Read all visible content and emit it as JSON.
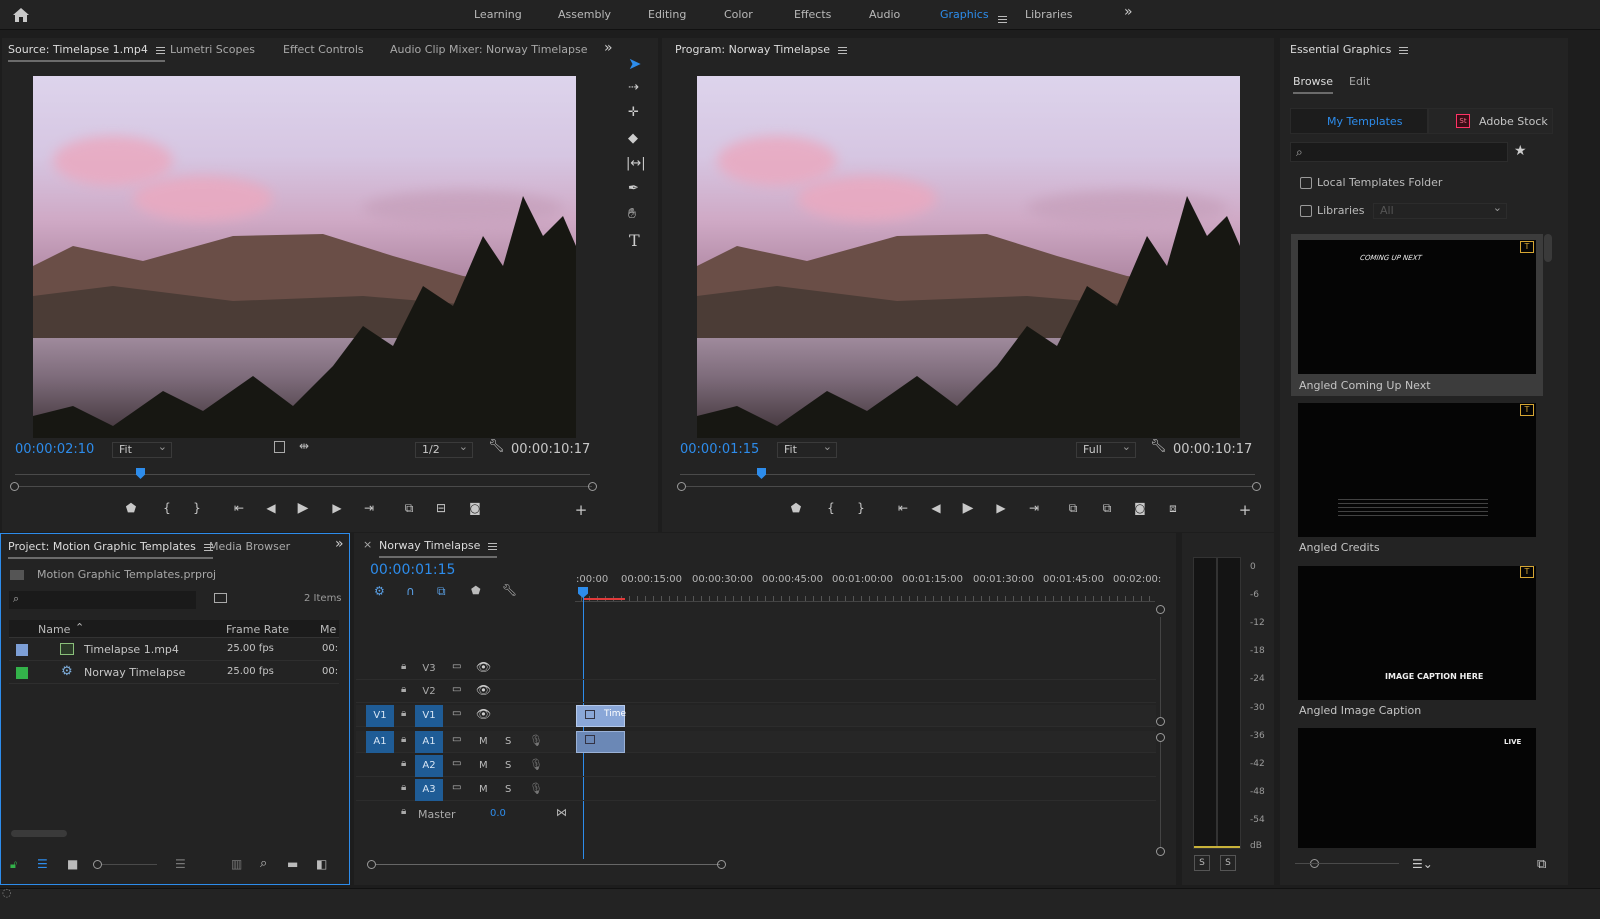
{
  "workspaces": {
    "items": [
      "Learning",
      "Assembly",
      "Editing",
      "Color",
      "Effects",
      "Audio",
      "Graphics",
      "Libraries"
    ],
    "active": "Graphics"
  },
  "source_panel": {
    "tabs": [
      "Source: Timelapse 1.mp4",
      "Lumetri Scopes",
      "Effect Controls",
      "Audio Clip Mixer: Norway Timelapse"
    ],
    "timecode": "00:00:02:10",
    "fit": "Fit",
    "resolution": "1/2",
    "duration": "00:00:10:17"
  },
  "program_panel": {
    "title": "Program: Norway Timelapse",
    "timecode": "00:00:01:15",
    "fit": "Fit",
    "resolution": "Full",
    "duration": "00:00:10:17"
  },
  "project_panel": {
    "tabs": [
      "Project: Motion Graphic Templates",
      "Media Browser"
    ],
    "file": "Motion Graphic Templates.prproj",
    "item_count": "2 Items",
    "columns": [
      "Name",
      "Frame Rate",
      "Me"
    ],
    "rows": [
      {
        "name": "Timelapse 1.mp4",
        "rate": "25.00 fps",
        "media": "00:",
        "color": "#7d9fd6"
      },
      {
        "name": "Norway Timelapse",
        "rate": "25.00 fps",
        "media": "00:",
        "color": "#33b24a"
      }
    ]
  },
  "timeline": {
    "title": "Norway Timelapse",
    "timecode": "00:00:01:15",
    "ruler": [
      ":00:00",
      "00:00:15:00",
      "00:00:30:00",
      "00:00:45:00",
      "00:01:00:00",
      "00:01:15:00",
      "00:01:30:00",
      "00:01:45:00",
      "00:02:00:"
    ],
    "video_tracks": [
      "V3",
      "V2",
      "V1"
    ],
    "audio_tracks": [
      "A1",
      "A2",
      "A3"
    ],
    "source_v": "V1",
    "source_a": "A1",
    "mute": "M",
    "solo": "S",
    "master_label": "Master",
    "master_value": "0.0",
    "clip_label": "Time"
  },
  "audio_meter": {
    "ticks": [
      "0",
      "-6",
      "-12",
      "-18",
      "-24",
      "-30",
      "-36",
      "-42",
      "-48",
      "-54",
      "dB"
    ],
    "solo_buttons": [
      "S",
      "S"
    ]
  },
  "essential_graphics": {
    "title": "Essential Graphics",
    "tabs": [
      "Browse",
      "Edit"
    ],
    "sources": [
      "My Templates",
      "Adobe Stock"
    ],
    "stock_badge": "St",
    "search_placeholder": "",
    "checkboxes": [
      "Local Templates Folder",
      "Libraries"
    ],
    "libraries_dropdown": "All",
    "templates": [
      {
        "name": "Angled Coming Up Next",
        "thumb_text": "COMING UP NEXT"
      },
      {
        "name": "Angled Credits",
        "thumb_text": ""
      },
      {
        "name": "Angled Image Caption",
        "thumb_text": "IMAGE CAPTION HERE"
      },
      {
        "name": "",
        "thumb_text": "LIVE"
      }
    ]
  }
}
